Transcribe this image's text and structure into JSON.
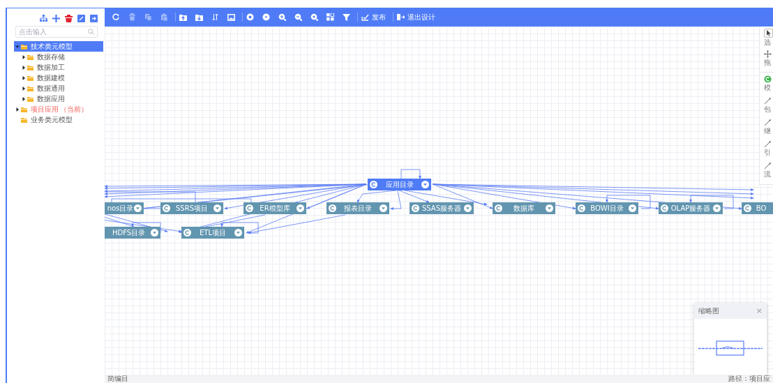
{
  "sidebar": {
    "search": {
      "placeholder": "点击输入"
    },
    "tree": [
      {
        "label": "技术类元模型",
        "selected": true,
        "expanded": true,
        "current": false,
        "children": [
          {
            "label": "数据存储",
            "selected": false,
            "expanded": false
          },
          {
            "label": "数据加工",
            "selected": false,
            "expanded": false
          },
          {
            "label": "数据建模",
            "selected": false,
            "expanded": false
          },
          {
            "label": "数据通用",
            "selected": false,
            "expanded": false
          },
          {
            "label": "数据应用",
            "selected": false,
            "expanded": false
          }
        ]
      },
      {
        "label": "项目应用",
        "tag": "（当前）",
        "selected": false,
        "expanded": false,
        "current": true
      },
      {
        "label": "业务类元模型",
        "selected": false,
        "current": false
      }
    ]
  },
  "toolbar": {
    "groups": [
      [
        {
          "kind": "refresh",
          "disabled": false
        },
        {
          "kind": "delete",
          "disabled": true
        },
        {
          "kind": "copy",
          "disabled": true
        },
        {
          "kind": "paste",
          "disabled": true
        }
      ],
      [
        {
          "kind": "import",
          "disabled": false
        },
        {
          "kind": "export",
          "disabled": false
        },
        {
          "kind": "sort",
          "disabled": false
        },
        {
          "kind": "image",
          "disabled": false
        }
      ],
      [
        {
          "kind": "zoom-fit",
          "disabled": false
        },
        {
          "kind": "zoom-actual",
          "disabled": false
        },
        {
          "kind": "zoom-in",
          "disabled": false
        },
        {
          "kind": "zoom-out",
          "disabled": false
        },
        {
          "kind": "zoom-search",
          "disabled": false
        },
        {
          "kind": "layout",
          "disabled": false
        },
        {
          "kind": "filter",
          "disabled": false
        }
      ],
      [
        {
          "kind": "publish",
          "label": "发布",
          "disabled": false
        }
      ],
      [
        {
          "kind": "exit",
          "label": "退出设计",
          "disabled": false
        }
      ]
    ]
  },
  "diagram": {
    "nodes": [
      {
        "label": "应用目录",
        "selected": true
      },
      {
        "label": "nos目录",
        "selected": false
      },
      {
        "label": "SSRS项目",
        "selected": false
      },
      {
        "label": "ER模型库",
        "selected": false
      },
      {
        "label": "报表目录",
        "selected": false
      },
      {
        "label": "SSAS服务器",
        "selected": false
      },
      {
        "label": "数据库",
        "selected": false
      },
      {
        "label": "BOWI目录",
        "selected": false
      },
      {
        "label": "OLAP服务器",
        "selected": false
      },
      {
        "label": "BO",
        "selected": false
      },
      {
        "label": "HDFS目录",
        "selected": false
      },
      {
        "label": "ETL项目",
        "selected": false
      }
    ]
  },
  "palette": {
    "items": [
      {
        "kind": "select",
        "label": "选",
        "selected": true
      },
      {
        "kind": "move",
        "label": "拖",
        "selected": false
      },
      {
        "kind": "model",
        "label": "模",
        "selected": false
      },
      {
        "kind": "line",
        "label": "包",
        "selected": false
      },
      {
        "kind": "line",
        "label": "继",
        "selected": false
      },
      {
        "kind": "line",
        "label": "引",
        "selected": false
      },
      {
        "kind": "line",
        "label": "流",
        "selected": false
      }
    ]
  },
  "minimap": {
    "title": "缩略图",
    "close": "×"
  },
  "status_bar": {
    "left": "简编目",
    "right": "路径：项目应"
  }
}
